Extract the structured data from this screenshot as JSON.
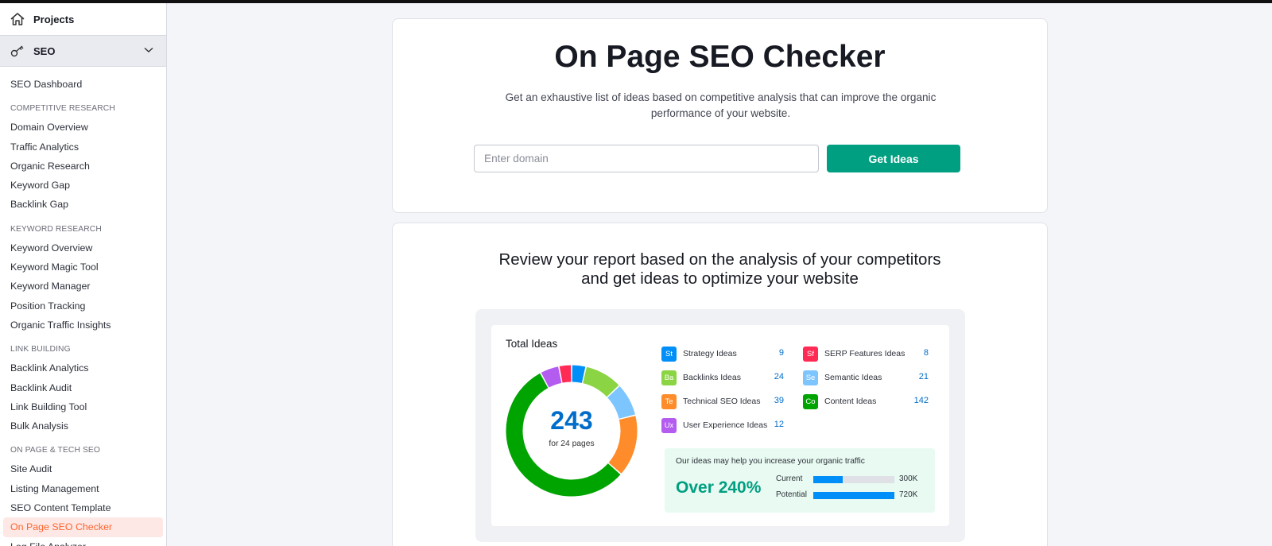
{
  "sidebar": {
    "projects_label": "Projects",
    "seo_label": "SEO",
    "dashboard_label": "SEO Dashboard",
    "sections": [
      {
        "heading": "COMPETITIVE RESEARCH",
        "items": [
          "Domain Overview",
          "Traffic Analytics",
          "Organic Research",
          "Keyword Gap",
          "Backlink Gap"
        ]
      },
      {
        "heading": "KEYWORD RESEARCH",
        "items": [
          "Keyword Overview",
          "Keyword Magic Tool",
          "Keyword Manager",
          "Position Tracking",
          "Organic Traffic Insights"
        ]
      },
      {
        "heading": "LINK BUILDING",
        "items": [
          "Backlink Analytics",
          "Backlink Audit",
          "Link Building Tool",
          "Bulk Analysis"
        ]
      },
      {
        "heading": "ON PAGE & TECH SEO",
        "items": [
          "Site Audit",
          "Listing Management",
          "SEO Content Template",
          "On Page SEO Checker",
          "Log File Analyzer"
        ]
      }
    ],
    "active_item": "On Page SEO Checker"
  },
  "hero": {
    "title": "On Page SEO Checker",
    "subtitle": "Get an exhaustive list of ideas based on competitive analysis that can improve the organic performance of your website.",
    "domain_placeholder": "Enter domain",
    "button_label": "Get Ideas"
  },
  "report": {
    "heading_line1": "Review your report based on the analysis of your competitors",
    "heading_line2": "and get ideas to optimize your website",
    "total_ideas_label": "Total Ideas",
    "total": "243",
    "total_sub": "for 24 pages",
    "ideas": [
      {
        "abbr": "St",
        "name": "Strategy Ideas",
        "value": 9,
        "color": "#008ff8"
      },
      {
        "abbr": "Sf",
        "name": "SERP Features Ideas",
        "value": 8,
        "color": "#ff2b55"
      },
      {
        "abbr": "Ba",
        "name": "Backlinks Ideas",
        "value": 24,
        "color": "#8bd443"
      },
      {
        "abbr": "Se",
        "name": "Semantic Ideas",
        "value": 21,
        "color": "#7dc5ff"
      },
      {
        "abbr": "Te",
        "name": "Technical SEO Ideas",
        "value": 39,
        "color": "#ff8c2b"
      },
      {
        "abbr": "Co",
        "name": "Content Ideas",
        "value": 142,
        "color": "#00a400"
      },
      {
        "abbr": "Ux",
        "name": "User Experience Ideas",
        "value": 12,
        "color": "#b45bf0"
      }
    ],
    "traffic": {
      "title": "Our ideas may help you increase your organic traffic",
      "increase": "Over 240%",
      "current_label": "Current",
      "current_value": "300K",
      "current_fraction": 0.36,
      "potential_label": "Potential",
      "potential_value": "720K",
      "potential_fraction": 1.0
    }
  }
}
